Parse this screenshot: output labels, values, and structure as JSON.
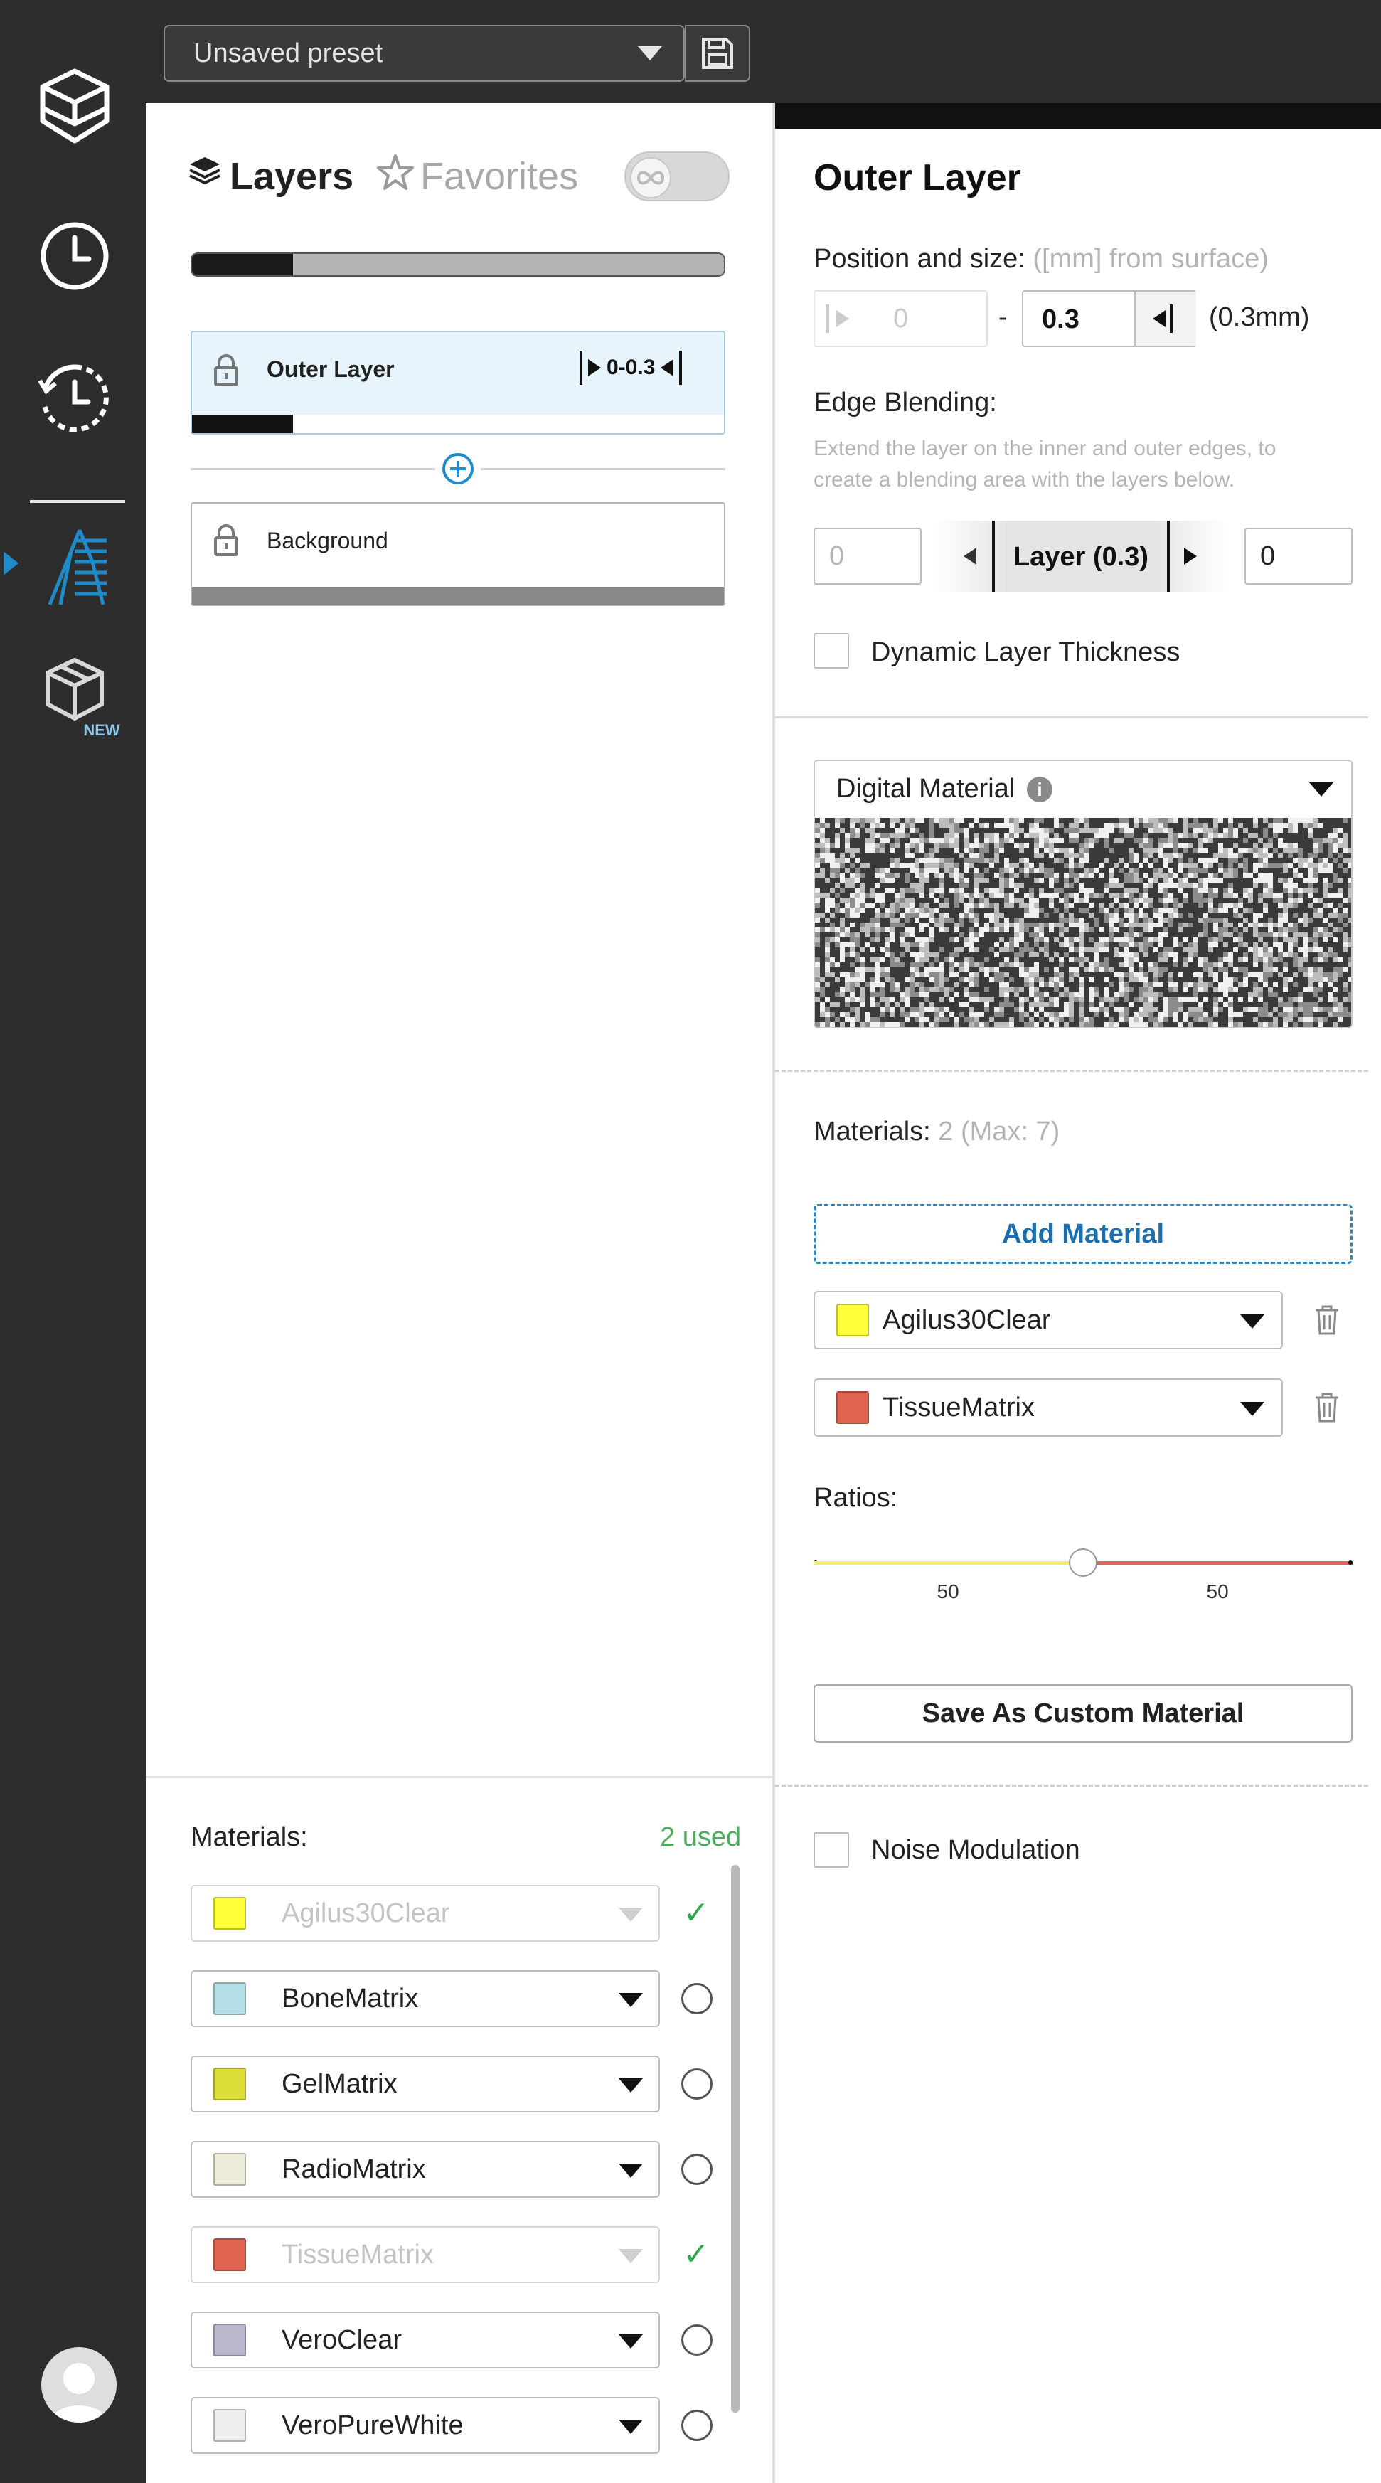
{
  "app": {
    "preset_label": "Unsaved preset"
  },
  "rail": {
    "icons": [
      "cube-icon",
      "clock-icon",
      "history-icon",
      "layers-figure-icon",
      "package-new-icon",
      "avatar"
    ],
    "new_badge": "NEW"
  },
  "tabs": {
    "layers": "Layers",
    "favorites": "Favorites"
  },
  "layers": {
    "progress": 0.19,
    "items": [
      {
        "name": "Outer Layer",
        "range": "0-0.3",
        "selected": true,
        "progress": 0.19
      },
      {
        "name": "Background",
        "selected": false
      }
    ]
  },
  "materials_panel": {
    "label": "Materials:",
    "used": "2 used",
    "items": [
      {
        "name": "Agilus30Clear",
        "color": "#ffff3a",
        "used": true
      },
      {
        "name": "BoneMatrix",
        "color": "#b5dfe6",
        "used": false
      },
      {
        "name": "GelMatrix",
        "color": "#dede3a",
        "used": false
      },
      {
        "name": "RadioMatrix",
        "color": "#ececd8",
        "used": false
      },
      {
        "name": "TissueMatrix",
        "color": "#df6552",
        "used": true
      },
      {
        "name": "VeroClear",
        "color": "#b9b7cc",
        "used": false
      },
      {
        "name": "VeroPureWhite",
        "color": "#eeeeee",
        "used": false
      }
    ]
  },
  "props": {
    "title": "Outer Layer",
    "position_label": "Position and size:",
    "position_unit": "([mm] from surface)",
    "from_value": "0",
    "dash": "-",
    "to_value": "0.3",
    "size_note": "(0.3mm)",
    "edge_label": "Edge Blending:",
    "edge_desc_1": "Extend the layer on the inner and outer edges, to",
    "edge_desc_2": "create a blending area with the layers below.",
    "edge_inner": "0",
    "edge_center": "Layer (0.3)",
    "edge_outer": "0",
    "dynamic_label": "Dynamic Layer Thickness",
    "digital_material_label": "Digital Material",
    "materials_label": "Materials:",
    "materials_count": "2 (Max: 7)",
    "add_material": "Add Material",
    "materials": [
      {
        "name": "Agilus30Clear",
        "color": "#ffff3a"
      },
      {
        "name": "TissueMatrix",
        "color": "#df6552"
      }
    ],
    "ratios_label": "Ratios:",
    "ratios": [
      50,
      50
    ],
    "ratio_labels": [
      "50",
      "50"
    ],
    "ratio_colors": [
      "#f2ee6a",
      "#df6552"
    ],
    "save_custom": "Save As Custom Material",
    "noise_label": "Noise Modulation"
  }
}
